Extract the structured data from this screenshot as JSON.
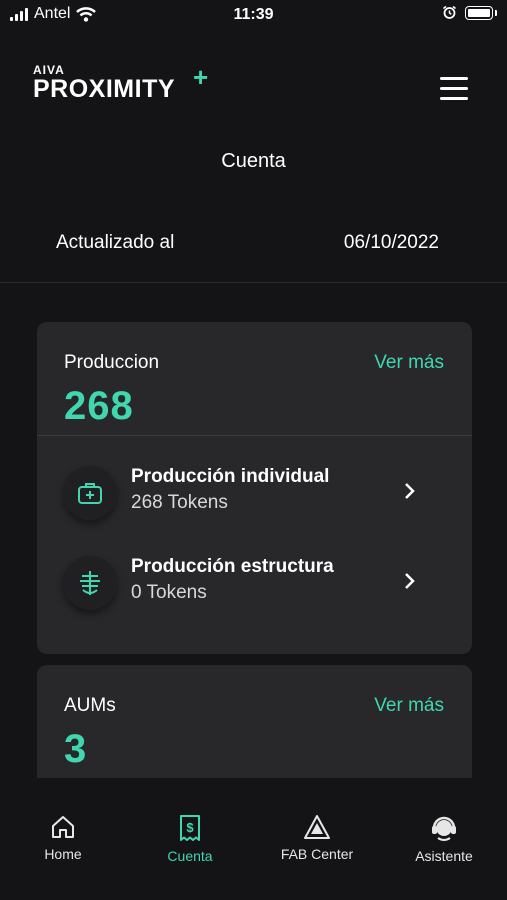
{
  "status_bar": {
    "carrier": "Antel",
    "time": "11:39"
  },
  "header": {
    "logo_small": "AIVA",
    "logo_main": "PROXIMITY",
    "logo_plus": "+"
  },
  "page": {
    "title": "Cuenta",
    "updated_label": "Actualizado al",
    "updated_date": "06/10/2022"
  },
  "production_card": {
    "title": "Produccion",
    "link": "Ver más",
    "value": "268",
    "items": [
      {
        "title": "Producción individual",
        "subtitle": "268 Tokens",
        "icon": "medical-case-icon"
      },
      {
        "title": "Producción estructura",
        "subtitle": "0 Tokens",
        "icon": "structure-icon"
      }
    ]
  },
  "aums_card": {
    "title": "AUMs",
    "link": "Ver más",
    "value": "3"
  },
  "bottom_nav": [
    {
      "label": "Home",
      "icon": "home-icon",
      "active": false
    },
    {
      "label": "Cuenta",
      "icon": "receipt-dollar-icon",
      "active": true
    },
    {
      "label": "FAB Center",
      "icon": "triangle-icon",
      "active": false
    },
    {
      "label": "Asistente",
      "icon": "assistant-headset-icon",
      "active": false
    }
  ],
  "colors": {
    "accent": "#3fd6b0",
    "background": "#141416",
    "card": "#28282b"
  }
}
